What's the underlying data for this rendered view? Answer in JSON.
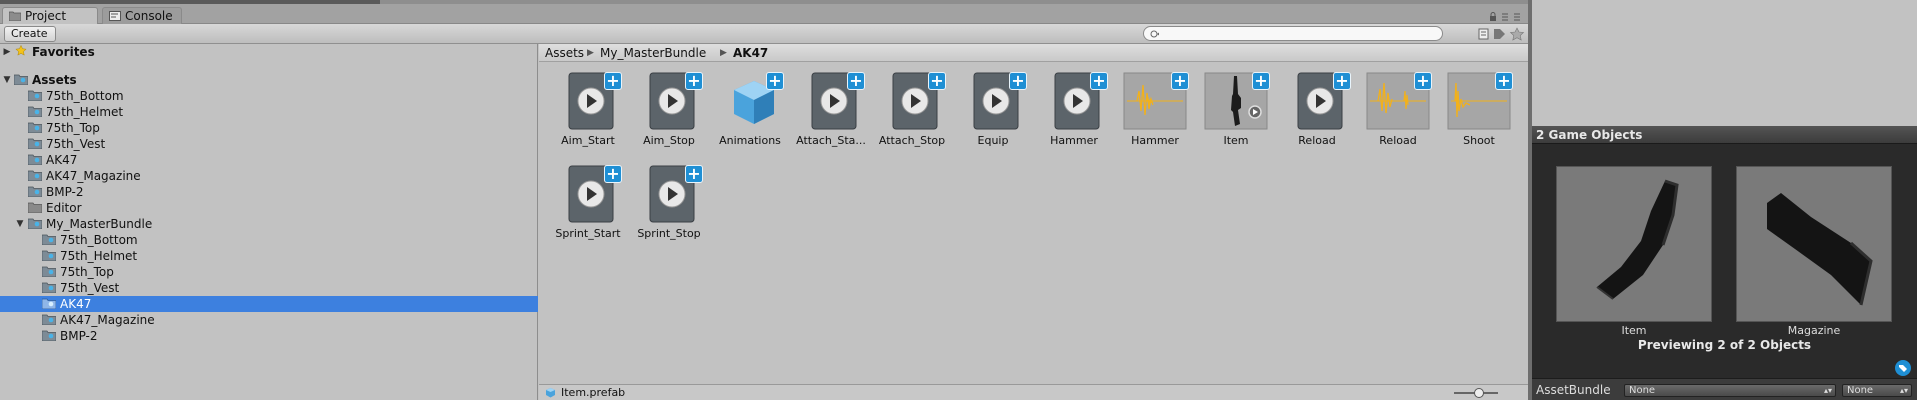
{
  "tabs": {
    "project": "Project",
    "console": "Console"
  },
  "toolbar": {
    "create_label": "Create",
    "search_placeholder": ""
  },
  "tree": {
    "favorites": "Favorites",
    "assets": "Assets",
    "items": [
      "75th_Bottom",
      "75th_Helmet",
      "75th_Top",
      "75th_Vest",
      "AK47",
      "AK47_Magazine",
      "BMP-2",
      "Editor",
      "My_MasterBundle"
    ],
    "subitems": [
      "75th_Bottom",
      "75th_Helmet",
      "75th_Top",
      "75th_Vest",
      "AK47",
      "AK47_Magazine",
      "BMP-2"
    ],
    "selected": "AK47"
  },
  "breadcrumb": {
    "root": "Assets",
    "parent": "My_MasterBundle",
    "current": "AK47"
  },
  "assets": [
    {
      "name": "Aim_Start",
      "kind": "animation"
    },
    {
      "name": "Aim_Stop",
      "kind": "animation"
    },
    {
      "name": "Animations",
      "kind": "prefab"
    },
    {
      "name": "Attach_Sta...",
      "kind": "animation"
    },
    {
      "name": "Attach_Stop",
      "kind": "animation"
    },
    {
      "name": "Equip",
      "kind": "animation"
    },
    {
      "name": "Hammer",
      "kind": "animation"
    },
    {
      "name": "Hammer",
      "kind": "audio"
    },
    {
      "name": "Item",
      "kind": "model"
    },
    {
      "name": "Reload",
      "kind": "animation"
    },
    {
      "name": "Reload",
      "kind": "audio"
    },
    {
      "name": "Shoot",
      "kind": "audio"
    },
    {
      "name": "Sprint_Start",
      "kind": "animation"
    },
    {
      "name": "Sprint_Stop",
      "kind": "animation"
    }
  ],
  "status": {
    "selected_file": "Item.prefab",
    "zoom": 0.6
  },
  "inspector": {
    "header": "2 Game Objects",
    "preview1_label": "Item",
    "preview2_label": "Magazine",
    "preview_count": "Previewing 2 of 2 Objects",
    "assetbundle_label": "AssetBundle",
    "bundle_value": "None",
    "variant_value": "None"
  },
  "colors": {
    "selection": "#3d80df",
    "plus_badge": "#1f8fd4",
    "audio_wave": "#f2b11b"
  }
}
